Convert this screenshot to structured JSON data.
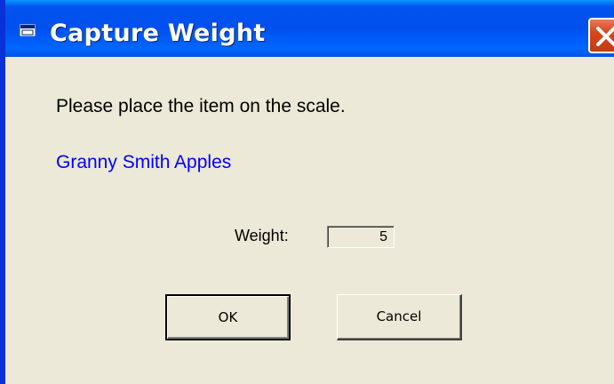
{
  "window": {
    "title": "Capture Weight"
  },
  "dialog": {
    "message": "Please place the item on the scale.",
    "item_name": "Granny Smith Apples",
    "weight_label": "Weight:",
    "weight_value": "5"
  },
  "buttons": {
    "ok_label": "OK",
    "cancel_label": "Cancel"
  },
  "colors": {
    "titlebar": "#0053ee",
    "window_background": "#ece9d8",
    "item_name_text": "#0000ff",
    "close_button": "#d6471c"
  },
  "icons": {
    "title_icon": "window-app-icon",
    "close_icon": "close-icon"
  }
}
